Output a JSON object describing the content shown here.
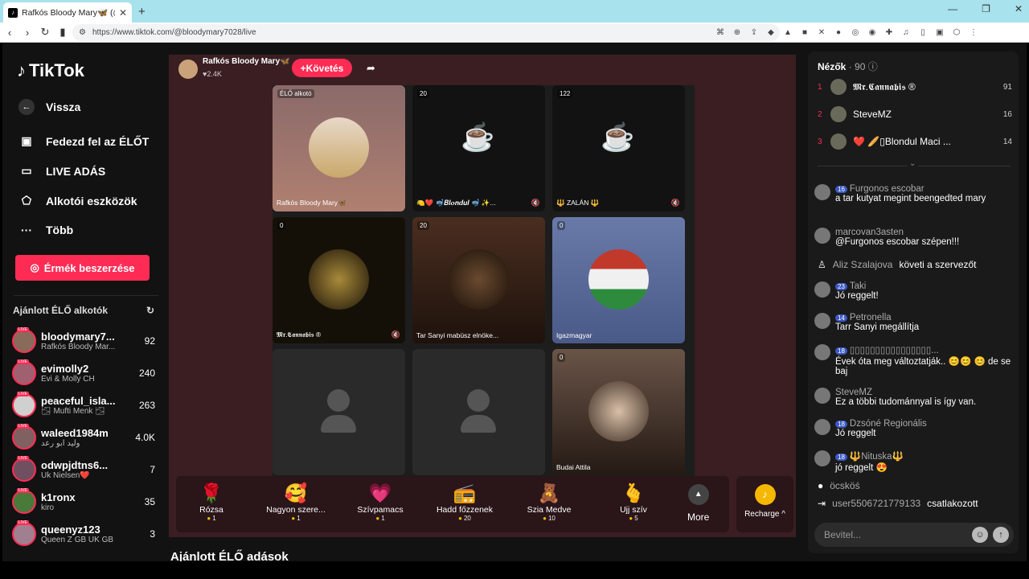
{
  "browser": {
    "tab_title": "Rafkós Bloody Mary🦋 (@blo",
    "url": "https://www.tiktok.com/@bloodymary7028/live"
  },
  "sidebar": {
    "logo": "TikTok",
    "back": "Vissza",
    "nav": [
      {
        "icon": "explore-live-icon",
        "label": "Fedezd fel az ÉLŐT"
      },
      {
        "icon": "camera-icon",
        "label": "LIVE ADÁS"
      },
      {
        "icon": "creator-tools-icon",
        "label": "Alkotói eszközök"
      },
      {
        "icon": "more-icon",
        "label": "Több"
      }
    ],
    "coins_button": "Érmék beszerzése",
    "recommended_title": "Ajánlott ÉLŐ alkotók",
    "live_tag": "LIVE",
    "creators": [
      {
        "name": "bloodymary7...",
        "sub": "Rafkós Bloody Mar...",
        "count": "92"
      },
      {
        "name": "evimolly2",
        "sub": "Évi & Molly CH",
        "count": "240"
      },
      {
        "name": "peaceful_isla...",
        "sub": "🌫 Mufti Menk 🌫",
        "count": "263"
      },
      {
        "name": "waleed1984m",
        "sub": "وليد ابو رعد",
        "count": "4.0K"
      },
      {
        "name": "odwpjdtns6...",
        "sub": "Uk Nielsen❤️",
        "count": "7"
      },
      {
        "name": "k1ronx",
        "sub": "kiro",
        "count": "35"
      },
      {
        "name": "queenyz123",
        "sub": "Queen Z GB UK GB",
        "count": "3"
      }
    ]
  },
  "stream": {
    "host_name": "Rafkós Bloody Mary🦋",
    "host_likes": "♥2.4K",
    "follow": "+Követés",
    "cells": [
      {
        "badge": "ÉLŐ alkotó",
        "label": "Rafkós Bloody Mary🦋"
      },
      {
        "badge": "20",
        "label": "🍋❤️ 🤿𝑩𝒍𝒐𝒏𝒅𝒖𝒍 🤿 ✨..."
      },
      {
        "badge": "122",
        "label": "🔱 ZALÁN 🔱"
      },
      {
        "badge": "0",
        "label": "𝕸𝖗.𝕮𝖆𝖓𝖓𝖆𝖇𝖎𝖘 ®"
      },
      {
        "badge": "20",
        "label": "Tar Sanyi mabüsz elnöke..."
      },
      {
        "badge": "0",
        "label": "Igazmagyar"
      },
      {
        "badge": "",
        "label": ""
      },
      {
        "badge": "",
        "label": ""
      },
      {
        "badge": "0",
        "label": "Budai Attila"
      }
    ],
    "gifts": [
      {
        "emoji": "🌹",
        "name": "Rózsa",
        "price": "1"
      },
      {
        "emoji": "🥰",
        "name": "Nagyon szere...",
        "price": "1"
      },
      {
        "emoji": "💗",
        "name": "Szívpamacs",
        "price": "1"
      },
      {
        "emoji": "📻",
        "name": "Hadd főzzenek",
        "price": "20"
      },
      {
        "emoji": "🧸",
        "name": "Szia Medve",
        "price": "10"
      },
      {
        "emoji": "🫰",
        "name": "Ujj szív",
        "price": "5"
      }
    ],
    "more": "More",
    "recharge": "Recharge ^",
    "below_title": "Ajánlott ÉLŐ adások"
  },
  "chat": {
    "viewers_label": "Nézők",
    "viewers_count": "· 90",
    "top_viewers": [
      {
        "rank": "1",
        "name": "𝕸𝖗.𝕮𝖆𝖓𝖓𝖆𝖇𝖎𝖘 ®",
        "score": "91"
      },
      {
        "rank": "2",
        "name": "SteveMZ",
        "score": "16"
      },
      {
        "rank": "3",
        "name": "❤️ 🥖▯Blondul Maci ...",
        "score": "14"
      }
    ],
    "messages": [
      {
        "tag": "16",
        "user": "Furgonos escobar",
        "text": "a tar kutyat megint beengedted mary"
      },
      {
        "tag": "",
        "user": "marcovan3asten",
        "text": "@Furgonos escobar szépen!!!"
      },
      {
        "tag": "23",
        "user": "Taki",
        "text": "Jó reggelt!"
      },
      {
        "tag": "14",
        "user": "Petronella",
        "text": "Tarr Sanyi megállítja"
      },
      {
        "tag": "18",
        "user": "▯▯▯▯▯▯▯▯▯▯▯▯▯▯▯▯...",
        "text": "Évek óta meg változtatják.. 😊😊 😊 de se baj"
      },
      {
        "tag": "",
        "user": "SteveMZ",
        "text": "Ez a többi tudománnyal is így van."
      },
      {
        "tag": "18",
        "user": "Dzsóné Regionális",
        "text": "Jó reggelt"
      },
      {
        "tag": "18",
        "user": "🔱Nituska🔱",
        "text": "jó reggelt 😍"
      }
    ],
    "system": [
      {
        "user": "Aliz Szalajova",
        "text": "követi a szervezőt"
      },
      {
        "user": "öcsköś",
        "text": ""
      },
      {
        "user": "user5506721779133",
        "text": "csatlakozott"
      }
    ],
    "input_placeholder": "Bevitel..."
  }
}
